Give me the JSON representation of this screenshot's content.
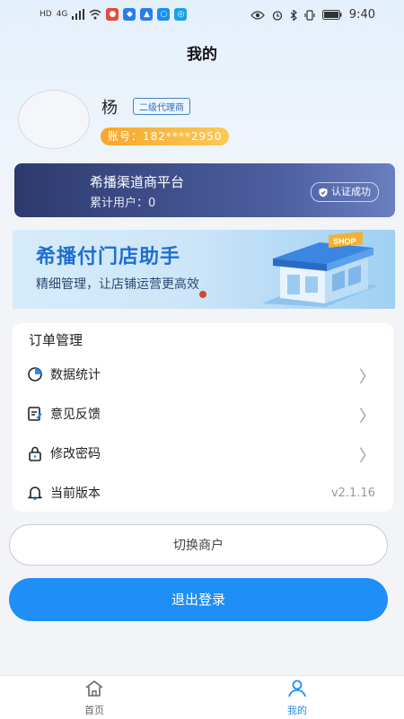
{
  "status_bar": {
    "left_tags": [
      "HD",
      "4G"
    ],
    "time": "9:40"
  },
  "page": {
    "title": "我的"
  },
  "profile": {
    "name": "杨",
    "level": "二级代理商",
    "account": "账号：182****2950"
  },
  "platform": {
    "name": "希播渠道商平台",
    "users": "累计用户：0",
    "verified": "认证成功"
  },
  "banner": {
    "title": "希播付门店助手",
    "subtitle": "精细管理，让店铺运营更高效",
    "shop_sign": "SHOP"
  },
  "menu": {
    "header": "订单管理",
    "items": [
      {
        "label": "数据统计",
        "icon": "pie-chart-icon"
      },
      {
        "label": "意见反馈",
        "icon": "feedback-icon"
      },
      {
        "label": "修改密码",
        "icon": "lock-icon"
      },
      {
        "label": "当前版本",
        "icon": "bell-icon",
        "value": "v2.1.16"
      }
    ]
  },
  "actions": {
    "switch_merchant": "切换商户",
    "logout": "退出登录"
  },
  "tabbar": {
    "home": "首页",
    "mine": "我的"
  },
  "colors": {
    "accent": "#1f8ef6",
    "account_pill": "#f8ae36",
    "platform_card": "#2d3a6e",
    "banner_text": "#1f6fd0"
  }
}
